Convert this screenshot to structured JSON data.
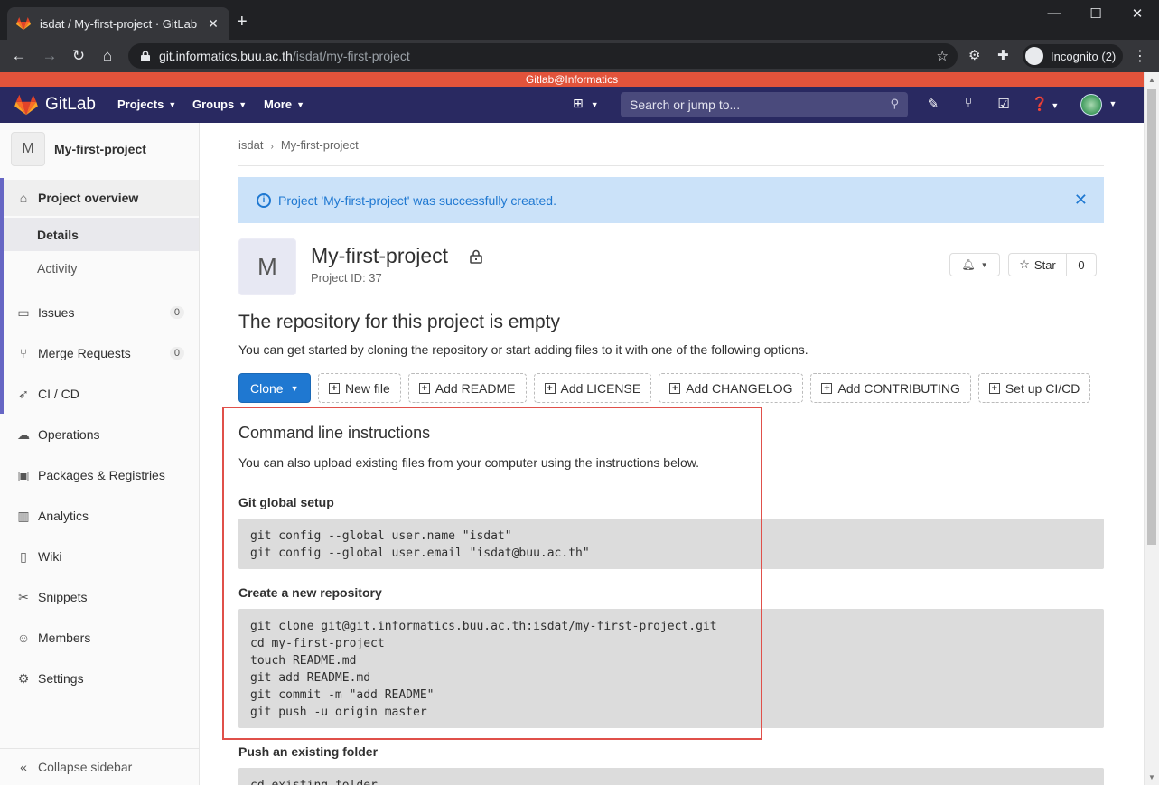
{
  "browser": {
    "tab_title": "isdat / My-first-project · GitLab",
    "new_tab": "+",
    "url_host": "git.informatics.buu.ac.th",
    "url_path": "/isdat/my-first-project",
    "incognito_label": "Incognito (2)"
  },
  "system_header": "Gitlab@Informatics",
  "navbar": {
    "brand": "GitLab",
    "menus": [
      "Projects",
      "Groups",
      "More"
    ],
    "search_placeholder": "Search or jump to..."
  },
  "sidebar": {
    "project_initial": "M",
    "project_name": "My-first-project",
    "overview": "Project overview",
    "sub_items": [
      "Details",
      "Activity"
    ],
    "items": [
      {
        "label": "Issues",
        "count": "0",
        "icon": "issues-icon"
      },
      {
        "label": "Merge Requests",
        "count": "0",
        "icon": "merge-request-icon"
      },
      {
        "label": "CI / CD",
        "icon": "rocket-icon"
      },
      {
        "label": "Operations",
        "icon": "cloud-icon"
      },
      {
        "label": "Packages & Registries",
        "icon": "package-icon"
      },
      {
        "label": "Analytics",
        "icon": "chart-icon"
      },
      {
        "label": "Wiki",
        "icon": "book-icon"
      },
      {
        "label": "Snippets",
        "icon": "scissors-icon"
      },
      {
        "label": "Members",
        "icon": "users-icon"
      },
      {
        "label": "Settings",
        "icon": "gear-icon"
      }
    ],
    "collapse": "Collapse sidebar"
  },
  "breadcrumb": {
    "group": "isdat",
    "project": "My-first-project"
  },
  "alert": "Project 'My-first-project' was successfully created.",
  "project": {
    "initial": "M",
    "title": "My-first-project",
    "id_label": "Project ID: 37",
    "star_label": "Star",
    "star_count": "0"
  },
  "empty": {
    "heading": "The repository for this project is empty",
    "text": "You can get started by cloning the repository or start adding files to it with one of the following options."
  },
  "buttons": {
    "clone": "Clone",
    "actions": [
      "New file",
      "Add README",
      "Add LICENSE",
      "Add CHANGELOG",
      "Add CONTRIBUTING",
      "Set up CI/CD"
    ]
  },
  "instructions": {
    "heading": "Command line instructions",
    "text": "You can also upload existing files from your computer using the instructions below.",
    "global_setup_title": "Git global setup",
    "global_setup_code": "git config --global user.name \"isdat\"\ngit config --global user.email \"isdat@buu.ac.th\"",
    "new_repo_title": "Create a new repository",
    "new_repo_code": "git clone git@git.informatics.buu.ac.th:isdat/my-first-project.git\ncd my-first-project\ntouch README.md\ngit add README.md\ngit commit -m \"add README\"\ngit push -u origin master",
    "existing_title": "Push an existing folder",
    "existing_code": "cd existing_folder"
  }
}
